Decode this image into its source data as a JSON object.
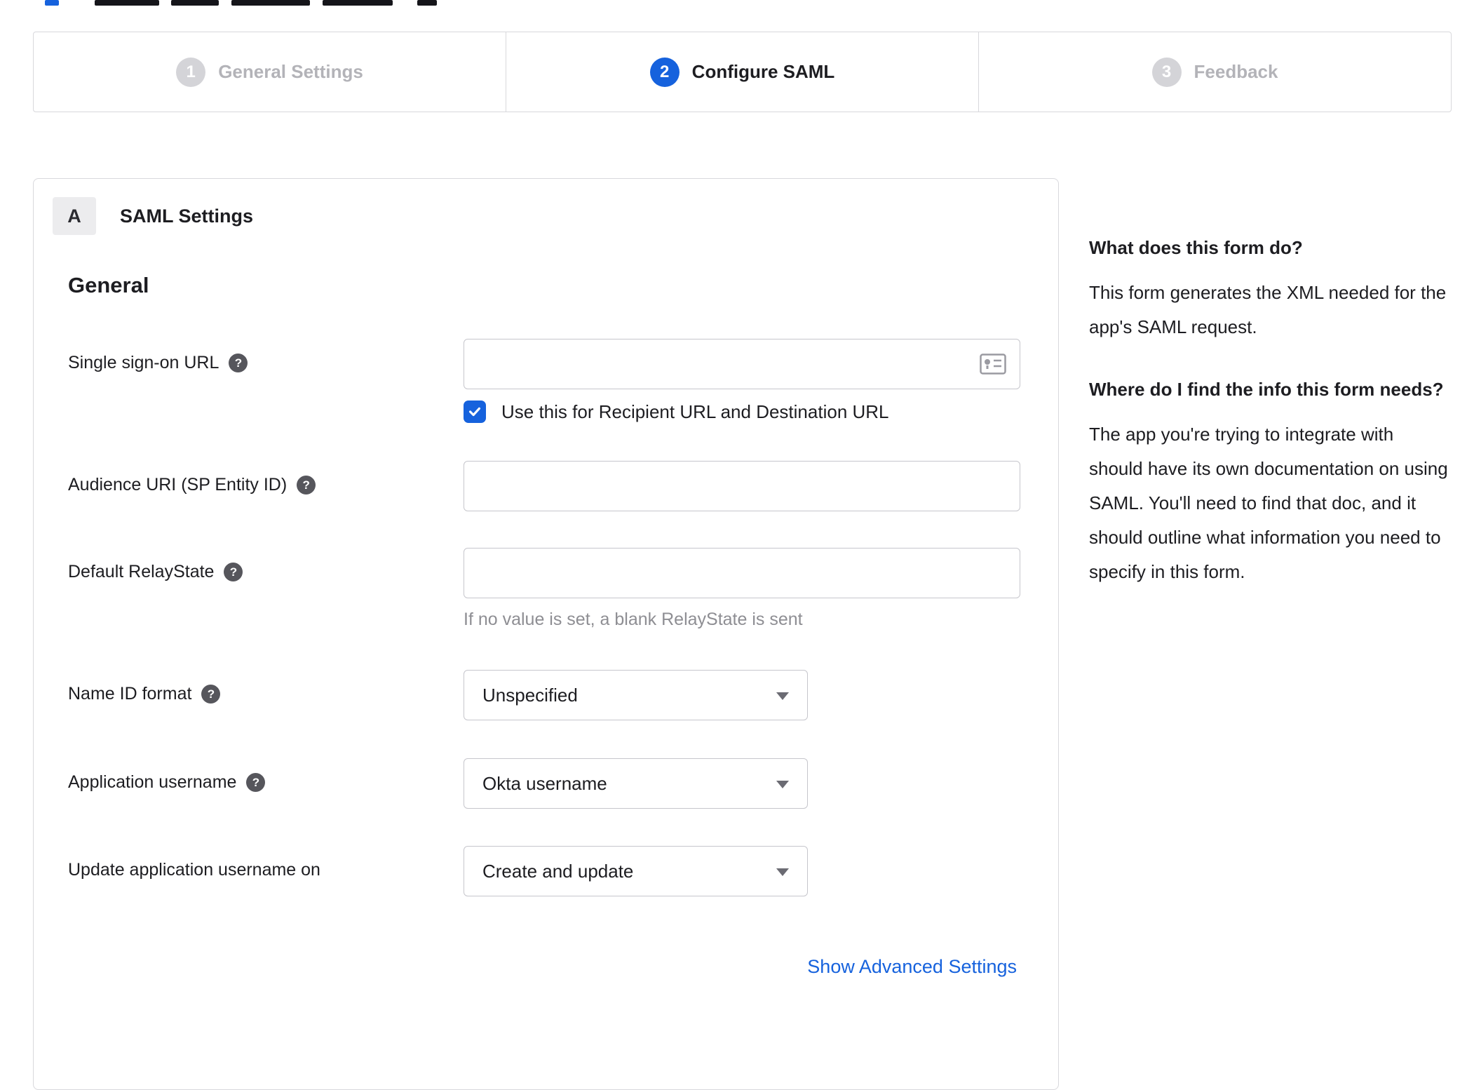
{
  "stepper": {
    "steps": [
      {
        "number": "1",
        "label": "General Settings",
        "state": "inactive"
      },
      {
        "number": "2",
        "label": "Configure SAML",
        "state": "active"
      },
      {
        "number": "3",
        "label": "Feedback",
        "state": "inactive"
      }
    ]
  },
  "card": {
    "section_badge": "A",
    "section_title": "SAML Settings",
    "general_heading": "General",
    "fields": {
      "sso": {
        "label": "Single sign-on URL",
        "value": "",
        "checkbox_label": "Use this for Recipient URL and Destination URL",
        "checked": true
      },
      "audience": {
        "label": "Audience URI (SP Entity ID)",
        "value": ""
      },
      "relay": {
        "label": "Default RelayState",
        "value": "",
        "hint": "If no value is set, a blank RelayState is sent"
      },
      "nameid": {
        "label": "Name ID format",
        "value": "Unspecified"
      },
      "appuser": {
        "label": "Application username",
        "value": "Okta username"
      },
      "update": {
        "label": "Update application username on",
        "value": "Create and update"
      }
    },
    "advanced_link": "Show Advanced Settings"
  },
  "sidebar": {
    "q1": "What does this form do?",
    "a1": "This form generates the XML needed for the app's SAML request.",
    "q2": "Where do I find the info this form needs?",
    "a2": "The app you're trying to integrate with should have its own documentation on using SAML. You'll need to find that doc, and it should outline what information you need to specify in this form."
  },
  "colors": {
    "accent": "#1662dd",
    "inactive_gray": "#d4d4d8",
    "border_gray": "#d8d8dc",
    "hint_gray": "#8e8e93"
  }
}
